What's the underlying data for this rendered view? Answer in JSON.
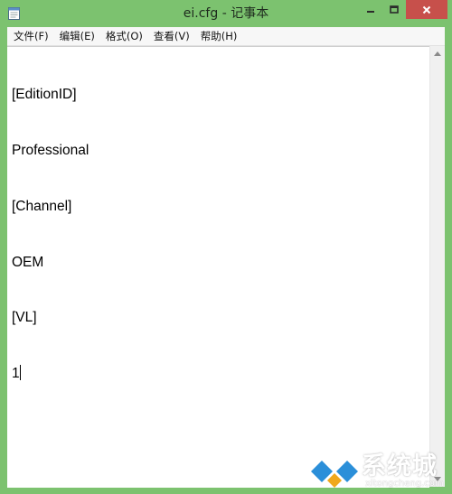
{
  "window": {
    "title": "ei.cfg - 记事本",
    "controls": {
      "minimize_icon": "minimize-icon",
      "maximize_icon": "maximize-icon",
      "close_icon": "close-icon"
    }
  },
  "menubar": {
    "items": [
      {
        "label": "文件(F)"
      },
      {
        "label": "编辑(E)"
      },
      {
        "label": "格式(O)"
      },
      {
        "label": "查看(V)"
      },
      {
        "label": "帮助(H)"
      }
    ]
  },
  "editor": {
    "lines": [
      "[EditionID]",
      "Professional",
      "[Channel]",
      "OEM",
      "[VL]",
      "1"
    ]
  },
  "watermark": {
    "brand": "系统城",
    "url": "xitongcheng.com"
  },
  "colors": {
    "frame": "#7cc26f",
    "close_button": "#c7504b",
    "editor_bg": "#ffffff",
    "menubar_bg": "#f7f7f7"
  }
}
